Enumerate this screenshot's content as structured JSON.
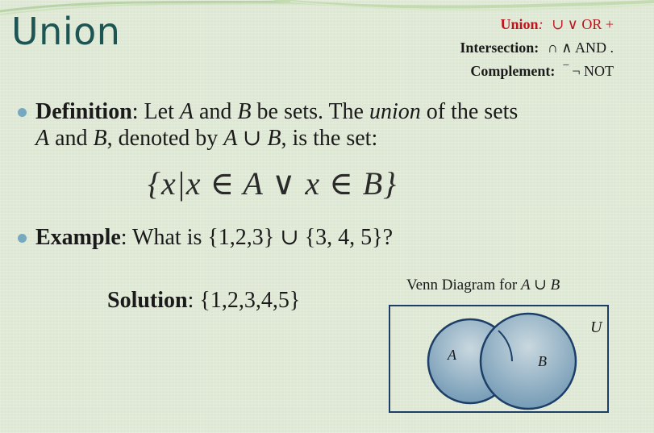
{
  "title": "Union",
  "legend": {
    "union_label": "Union",
    "union_colon": ":",
    "union_symbols": "∪  ∨   OR  +",
    "intersection_label": "Intersection:",
    "intersection_symbols": "∩  ∧ AND  .",
    "complement_label": "Complement:",
    "complement_symbols": "‾  ¬   NOT"
  },
  "definition": {
    "label": "Definition",
    "text_1": ": Let ",
    "a": "A",
    "text_2": " and ",
    "b": "B",
    "text_3": " be sets. The ",
    "union_word": "union",
    "text_4": " of the sets ",
    "a2": "A",
    "text_5": " and ",
    "b2": "B",
    "text_6": ", denoted by ",
    "expr": "A ∪ B",
    "text_7": ",  is the set:"
  },
  "set_builder": "{x|x ∈ A ∨ x ∈ B}",
  "example": {
    "label": "Example",
    "text": ": What is  {1,2,3}  ∪ {3, 4, 5}?"
  },
  "solution": {
    "label": "Solution",
    "text": ": {1,2,3,4,5}"
  },
  "venn": {
    "caption_prefix": "Venn Diagram for ",
    "caption_expr": "A ∪ B",
    "universe_label": "U",
    "set_a_label": "A",
    "set_b_label": "B",
    "fill_color": "#7fa6bf",
    "stroke_color": "#1d3e67"
  }
}
